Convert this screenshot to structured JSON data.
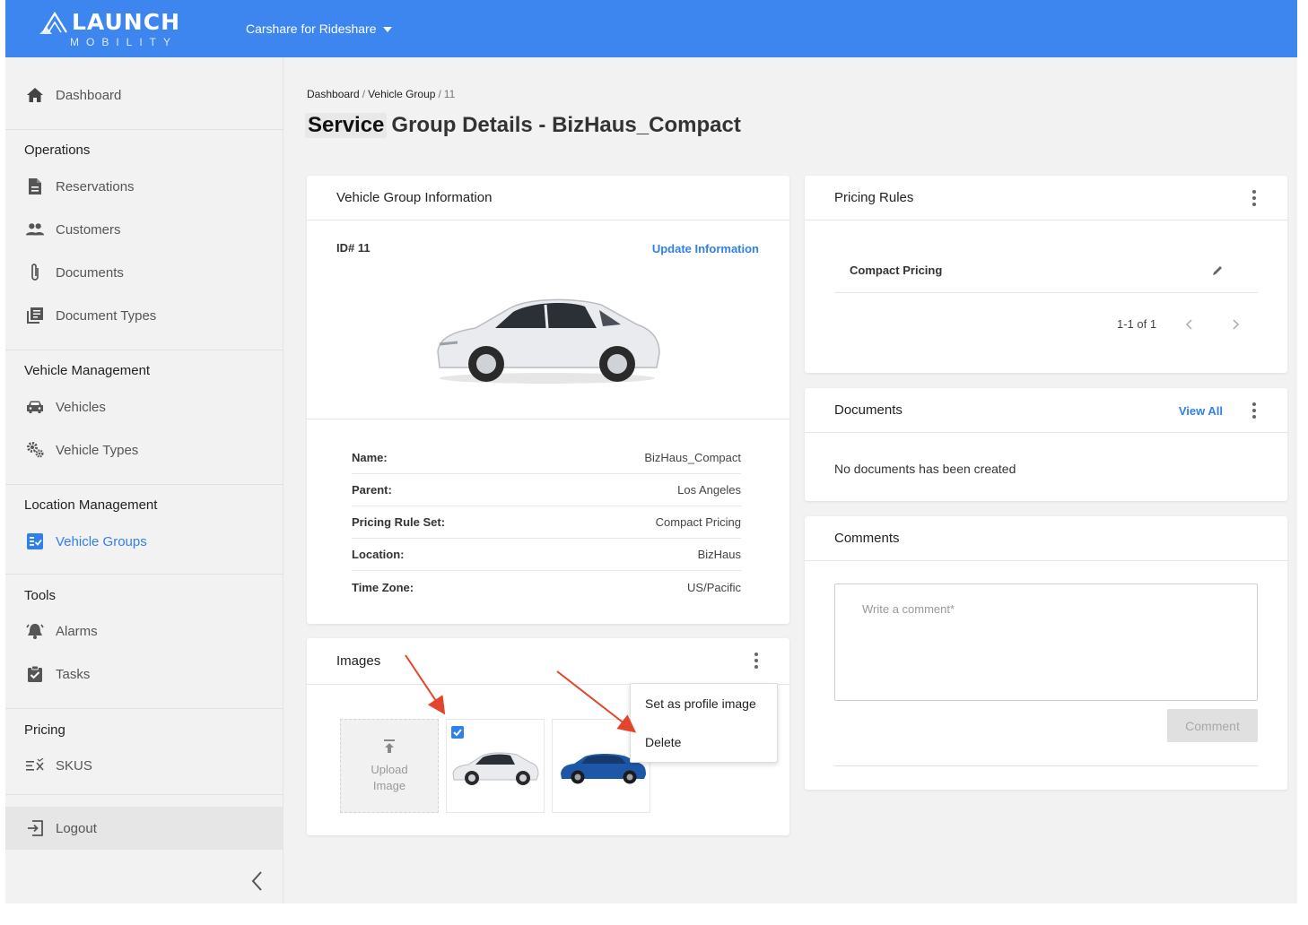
{
  "topbar": {
    "logo_title": "LAUNCH",
    "logo_sub": "MOBILITY",
    "app_selector": "Carshare for Rideshare",
    "bg_color": "#3d86f0"
  },
  "sidebar": {
    "dashboard": "Dashboard",
    "sections": {
      "operations": "Operations",
      "vehicle_management": "Vehicle Management",
      "location_management": "Location Management",
      "tools": "Tools",
      "pricing": "Pricing"
    },
    "items": {
      "reservations": "Reservations",
      "customers": "Customers",
      "documents": "Documents",
      "document_types": "Document Types",
      "vehicles": "Vehicles",
      "vehicle_types": "Vehicle Types",
      "vehicle_groups": "Vehicle Groups",
      "alarms": "Alarms",
      "tasks": "Tasks",
      "skus": "SKUS"
    },
    "logout": "Logout",
    "active_color": "#2f80ed"
  },
  "breadcrumb": {
    "home": "Dashboard",
    "sep": "/",
    "section": "Vehicle Group",
    "current": "11"
  },
  "page": {
    "title_highlight": "Service",
    "title_rest": "Group Details - BizHaus_Compact"
  },
  "info_card": {
    "title": "Vehicle Group Information",
    "id_label": "ID# 11",
    "update_link": "Update Information",
    "rows": [
      {
        "key": "Name:",
        "value": "BizHaus_Compact"
      },
      {
        "key": "Parent:",
        "value": "Los Angeles"
      },
      {
        "key": "Pricing Rule Set:",
        "value": "Compact Pricing"
      },
      {
        "key": "Location:",
        "value": "BizHaus"
      },
      {
        "key": "Time Zone:",
        "value": "US/Pacific"
      }
    ]
  },
  "images_card": {
    "title": "Images",
    "upload_line1": "Upload",
    "upload_line2": "Image",
    "menu": {
      "set_profile": "Set as profile image",
      "delete": "Delete"
    }
  },
  "pricing_card": {
    "title": "Pricing Rules",
    "rule_name": "Compact Pricing",
    "pagination": "1-1 of 1"
  },
  "documents_card": {
    "title": "Documents",
    "view_all": "View All",
    "empty_text": "No documents has been created"
  },
  "comments_card": {
    "title": "Comments",
    "placeholder": "Write a comment*",
    "button": "Comment"
  },
  "icons": {
    "dashboard": "home-icon",
    "reservations": "file-icon",
    "customers": "people-icon",
    "documents": "paperclip-icon",
    "document_types": "library-icon",
    "vehicles": "car-icon",
    "vehicle_types": "gears-icon",
    "vehicle_groups": "checklist-icon",
    "alarms": "alarm-bell-icon",
    "tasks": "clipboard-check-icon",
    "skus": "sku-list-icon",
    "logout": "logout-icon"
  }
}
